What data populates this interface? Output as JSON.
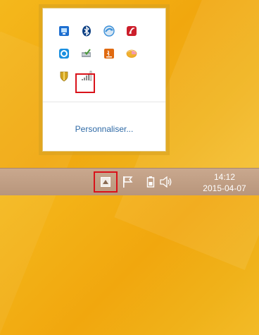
{
  "tray_popup": {
    "customize_label": "Personnaliser...",
    "icons": [
      {
        "name": "monitor-app-icon",
        "color": "#1e6fd0"
      },
      {
        "name": "bluetooth-icon",
        "color": "#0a3e82"
      },
      {
        "name": "sync-globe-icon",
        "color": "#3a8fd8"
      },
      {
        "name": "acrobat-updater-icon",
        "color": "#cc1e2b"
      },
      {
        "name": "cloud-sync-icon",
        "color": "#1a8fe0"
      },
      {
        "name": "safely-remove-hardware-icon",
        "color": "#4a9a3a"
      },
      {
        "name": "java-update-icon",
        "color": "#e06a10"
      },
      {
        "name": "disk-pie-icon",
        "color": "#f0b030"
      },
      {
        "name": "security-shield-icon",
        "color": "#d4a520"
      },
      {
        "name": "network-signal-icon",
        "color": "#8a8a8a"
      }
    ]
  },
  "taskbar": {
    "time": "14:12",
    "date": "2015-04-07"
  },
  "colors": {
    "highlight": "#d9121a",
    "wallpaper": "#f2b21a",
    "taskbar": "#bf9c82",
    "link": "#2f6aa6"
  }
}
